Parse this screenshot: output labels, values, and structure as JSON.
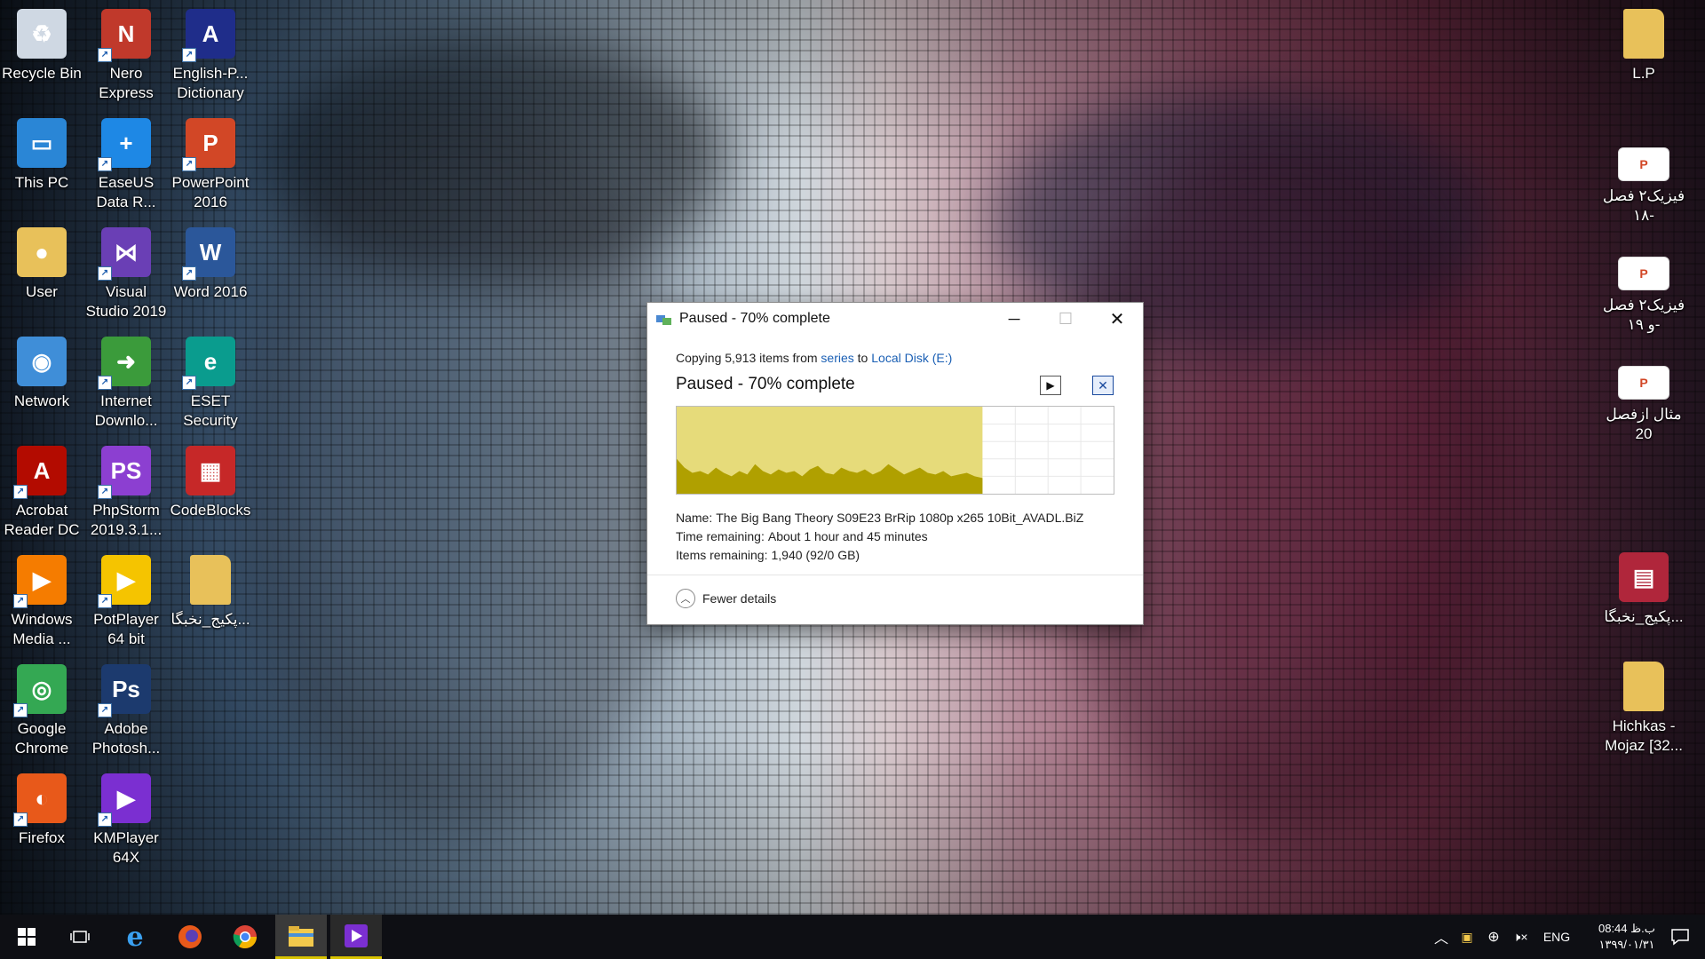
{
  "desktop": {
    "icons_left": [
      {
        "label": "Recycle Bin",
        "icon": "recycle-bin-icon",
        "color": "#cfd8e3",
        "glyph": "♻",
        "shortcut": false
      },
      {
        "label": "Nero Express",
        "icon": "nero-express-icon",
        "color": "#c0392b",
        "glyph": "N",
        "shortcut": true
      },
      {
        "label": "English-P... Dictionary",
        "icon": "dictionary-icon",
        "color": "#1f2d8a",
        "glyph": "A",
        "shortcut": true
      },
      {
        "label": "This PC",
        "icon": "this-pc-icon",
        "color": "#2a86d6",
        "glyph": "▭",
        "shortcut": false
      },
      {
        "label": "EaseUS Data R...",
        "icon": "easeus-icon",
        "color": "#1e88e5",
        "glyph": "+",
        "shortcut": true
      },
      {
        "label": "PowerPoint 2016",
        "icon": "powerpoint-icon",
        "color": "#d24726",
        "glyph": "P",
        "shortcut": true
      },
      {
        "label": "User",
        "icon": "user-folder-icon",
        "color": "#e8c15a",
        "glyph": "●",
        "shortcut": false
      },
      {
        "label": "Visual Studio 2019",
        "icon": "visual-studio-icon",
        "color": "#6a3fb5",
        "glyph": "⋈",
        "shortcut": true
      },
      {
        "label": "Word 2016",
        "icon": "word-icon",
        "color": "#2b579a",
        "glyph": "W",
        "shortcut": true
      },
      {
        "label": "Network",
        "icon": "network-icon",
        "color": "#3f8ed8",
        "glyph": "◉",
        "shortcut": false
      },
      {
        "label": "Internet Downlo...",
        "icon": "internet-download-manager-icon",
        "color": "#3b9b3b",
        "glyph": "➜",
        "shortcut": true
      },
      {
        "label": "ESET Security",
        "icon": "eset-icon",
        "color": "#0a9c8e",
        "glyph": "e",
        "shortcut": true
      },
      {
        "label": "Acrobat Reader DC",
        "icon": "acrobat-icon",
        "color": "#b30b00",
        "glyph": "A",
        "shortcut": true
      },
      {
        "label": "PhpStorm 2019.3.1...",
        "icon": "phpstorm-icon",
        "color": "#8c3fd1",
        "glyph": "PS",
        "shortcut": true
      },
      {
        "label": "CodeBlocks",
        "icon": "codeblocks-icon",
        "color": "#c62828",
        "glyph": "▦",
        "shortcut": false
      },
      {
        "label": "Windows Media ...",
        "icon": "windows-media-player-icon",
        "color": "#f57c00",
        "glyph": "▶",
        "shortcut": true
      },
      {
        "label": "PotPlayer 64 bit",
        "icon": "potplayer-icon",
        "color": "#f5c400",
        "glyph": "▶",
        "shortcut": true
      },
      {
        "label": "پکیج_نخبگا...",
        "icon": "folder-icon",
        "color": "#e8c15a",
        "glyph": "",
        "shortcut": false
      },
      {
        "label": "Google Chrome",
        "icon": "chrome-icon",
        "color": "#34a853",
        "glyph": "◎",
        "shortcut": true
      },
      {
        "label": "Adobe Photosh...",
        "icon": "photoshop-icon",
        "color": "#1c3a6e",
        "glyph": "Ps",
        "shortcut": true
      },
      {
        "label": "Firefox",
        "icon": "firefox-icon",
        "color": "#e8591a",
        "glyph": "◐",
        "shortcut": true
      },
      {
        "label": "KMPlayer 64X",
        "icon": "kmplayer-icon",
        "color": "#7b2fd1",
        "glyph": "▶",
        "shortcut": true
      }
    ],
    "icons_right": [
      {
        "label": "L.P",
        "icon": "folder-icon",
        "color": "#e8c15a",
        "glyph": ""
      },
      {
        "label": "فیزیک۲ فصل ۱۸-",
        "icon": "pptx-file-icon",
        "color": "#ffffff",
        "glyph": "P"
      },
      {
        "label": "فیزیک۲ فصل و ۱۹-",
        "icon": "pptx-file-icon",
        "color": "#ffffff",
        "glyph": "P"
      },
      {
        "label": "مثال ازفصل 20",
        "icon": "pptx-file-icon",
        "color": "#ffffff",
        "glyph": "P"
      },
      {
        "label": "پکیج_نخبگا...",
        "icon": "winrar-icon",
        "color": "#b0263b",
        "glyph": "▤"
      },
      {
        "label": "Hichkas - Mojaz [32...",
        "icon": "folder-icon",
        "color": "#e8c15a",
        "glyph": ""
      }
    ]
  },
  "dialog": {
    "title": "Paused - 70% complete",
    "copy_prefix": "Copying 5,913 items from",
    "source": "series",
    "to": "to",
    "destination": "Local Disk (E:)",
    "status": "Paused - 70% complete",
    "progress_percent": 70,
    "speed_graph_levels": [
      0.4,
      0.3,
      0.24,
      0.26,
      0.22,
      0.3,
      0.24,
      0.2,
      0.26,
      0.22,
      0.34,
      0.26,
      0.22,
      0.28,
      0.24,
      0.26,
      0.2,
      0.28,
      0.32,
      0.24,
      0.22,
      0.3,
      0.26,
      0.24,
      0.28,
      0.22,
      0.26,
      0.34,
      0.28,
      0.22,
      0.26,
      0.3,
      0.24,
      0.22,
      0.26,
      0.2,
      0.22,
      0.24,
      0.2,
      0.18
    ],
    "name_label": "Name:",
    "name_value": "The Big Bang Theory S09E23 BrRip 1080p x265 10Bit_AVADL.BiZ",
    "time_label": "Time remaining:",
    "time_value": "About 1 hour and 45 minutes",
    "items_label": "Items remaining:",
    "items_value": "1,940 (92/0 GB)",
    "fewer_details": "Fewer details",
    "graph_fill": "#e6db7a",
    "graph_line": "#b0a000"
  },
  "taskbar": {
    "language": "ENG",
    "time": "08:44 ب.ظ",
    "date": "۱۳۹۹/۰۱/۳۱",
    "accent": "#d8c300"
  }
}
